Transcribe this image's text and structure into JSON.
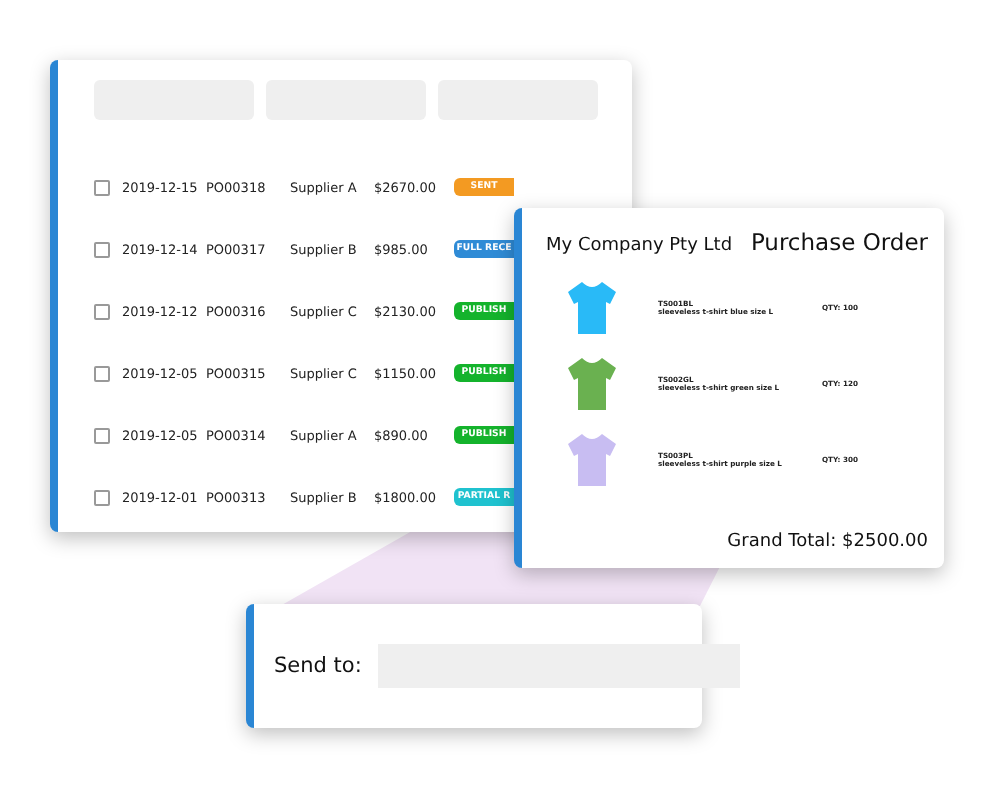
{
  "orders_table": {
    "rows": [
      {
        "checked": false,
        "date": "2019-12-15",
        "po": "PO00318",
        "supplier": "Supplier A",
        "amount": "$2670.00",
        "status": "SENT",
        "color": "#f39a22"
      },
      {
        "checked": false,
        "date": "2019-12-14",
        "po": "PO00317",
        "supplier": "Supplier B",
        "amount": "$985.00",
        "status": "FULL RECE",
        "color": "#2f8bd6"
      },
      {
        "checked": false,
        "date": "2019-12-12",
        "po": "PO00316",
        "supplier": "Supplier C",
        "amount": "$2130.00",
        "status": "PUBLISH",
        "color": "#14b32c"
      },
      {
        "checked": false,
        "date": "2019-12-05",
        "po": "PO00315",
        "supplier": "Supplier C",
        "amount": "$1150.00",
        "status": "PUBLISH",
        "color": "#14b32c"
      },
      {
        "checked": false,
        "date": "2019-12-05",
        "po": "PO00314",
        "supplier": "Supplier A",
        "amount": "$890.00",
        "status": "PUBLISH",
        "color": "#14b32c"
      },
      {
        "checked": false,
        "date": "2019-12-01",
        "po": "PO00313",
        "supplier": "Supplier B",
        "amount": "$1800.00",
        "status": "PARTIAL R",
        "color": "#1fc2cf"
      }
    ]
  },
  "purchase_order": {
    "company": "My Company Pty Ltd",
    "title": "Purchase Order",
    "items": [
      {
        "color": "#29baf7",
        "code": "TS001BL",
        "description": "sleeveless t-shirt blue size L",
        "qty": "QTY: 100"
      },
      {
        "color": "#6ab150",
        "code": "TS002GL",
        "description": "sleeveless t-shirt green size L",
        "qty": "QTY: 120"
      },
      {
        "color": "#c8bdf2",
        "code": "TS003PL",
        "description": "sleeveless t-shirt purple size L",
        "qty": "QTY: 300"
      }
    ],
    "grand_total": "Grand Total: $2500.00"
  },
  "send": {
    "label": "Send to:"
  }
}
